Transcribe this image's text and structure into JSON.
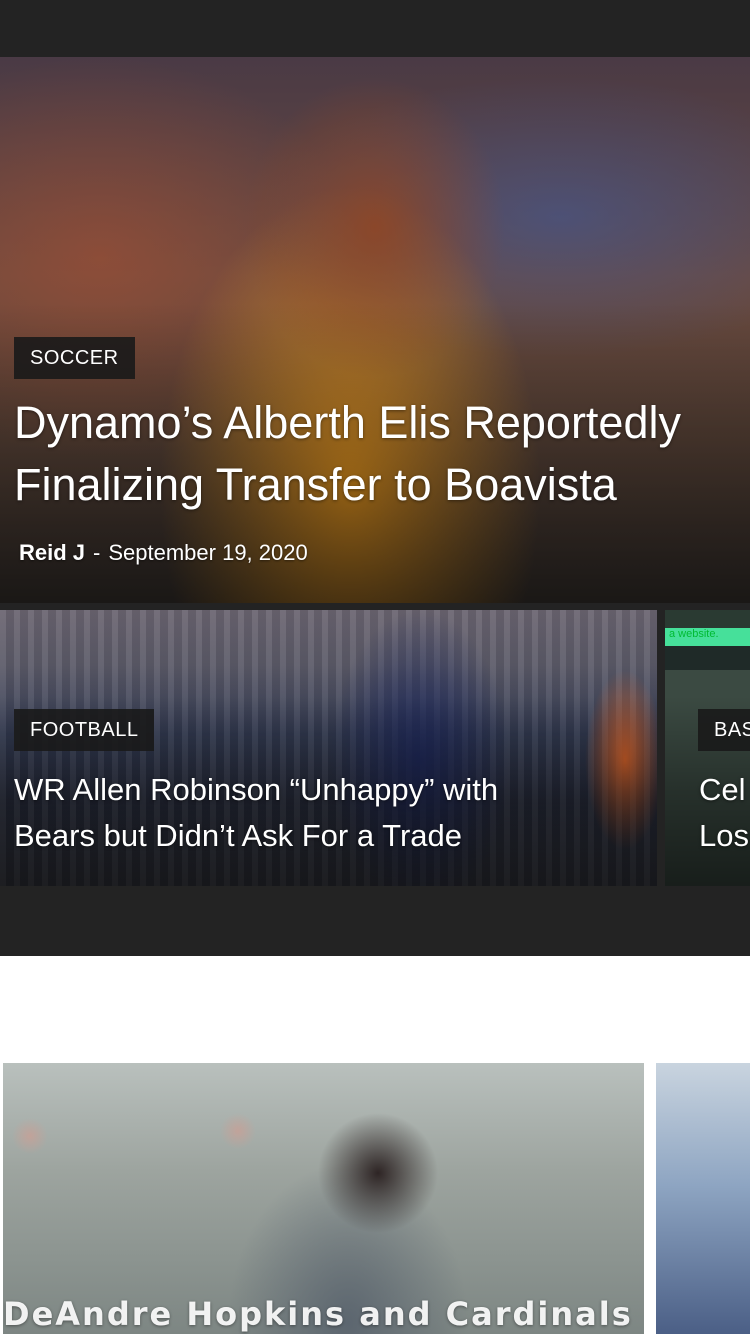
{
  "hero": {
    "category": "SOCCER",
    "title": "Dynamo’s Alberth Elis Reportedly\nFinalizing Transfer to Boavista",
    "author": "Reid J",
    "separator": "-",
    "date": "September 19, 2020"
  },
  "carousel": [
    {
      "category": "FOOTBALL",
      "title": "WR Allen Robinson “Unhappy” with\nBears but Didn’t Ask For a Trade"
    },
    {
      "category": "BAS",
      "title": "Cel\nLos",
      "overlay_text": "a website."
    }
  ],
  "lower": [
    {
      "title": "DeAndre Hopkins and Cardinals"
    }
  ]
}
